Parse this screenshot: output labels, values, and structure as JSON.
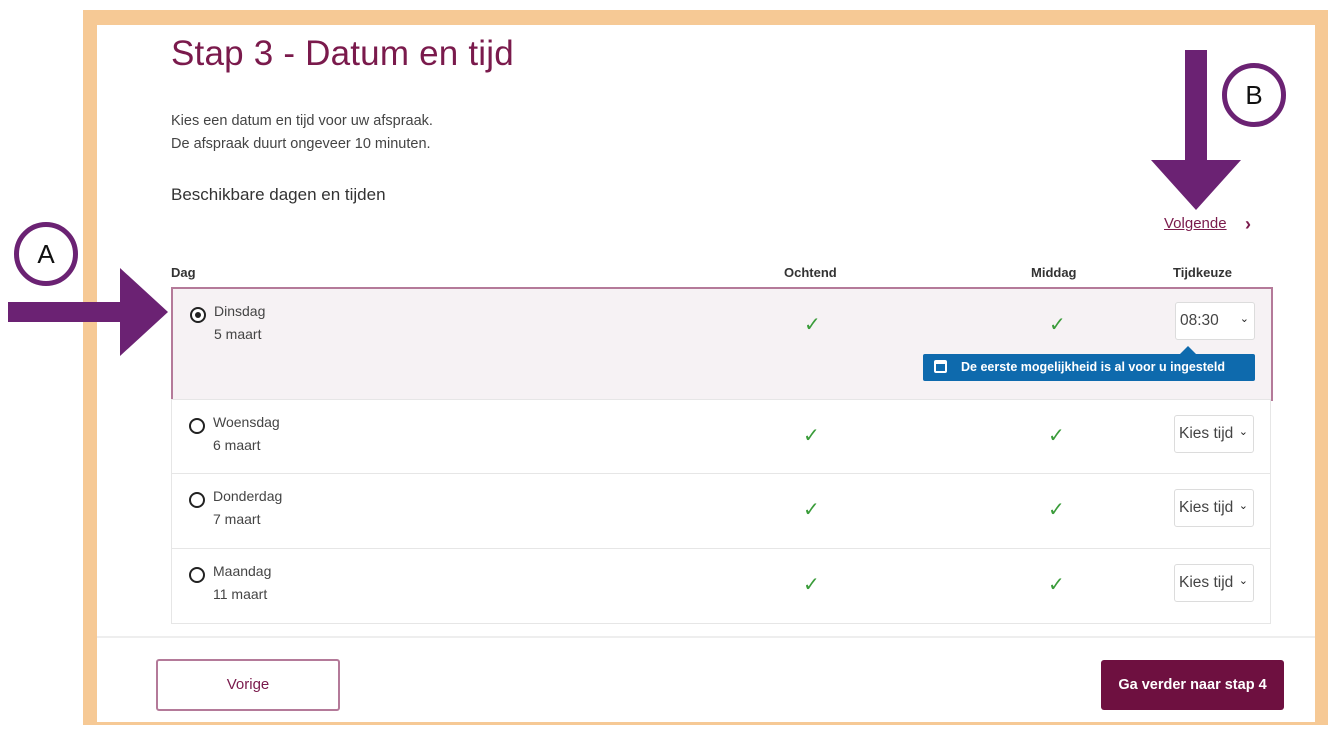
{
  "page": {
    "title": "Stap 3 - Datum en tijd",
    "intro_line1": "Kies een datum en tijd voor uw afspraak.",
    "intro_line2": "De afspraak duurt ongeveer 10 minuten.",
    "subhead": "Beschikbare dagen en tijden",
    "next_link": "Volgende",
    "next_chevron": "›"
  },
  "table": {
    "headers": {
      "day": "Dag",
      "morning": "Ochtend",
      "afternoon": "Middag",
      "time": "Tijdkeuze"
    },
    "check_glyph": "✓",
    "caret_glyph": "⌄",
    "rows": [
      {
        "day": "Dinsdag",
        "date": "5 maart",
        "selected": true,
        "time": "08:30"
      },
      {
        "day": "Woensdag",
        "date": "6 maart",
        "selected": false,
        "time": "Kies tijd"
      },
      {
        "day": "Donderdag",
        "date": "7 maart",
        "selected": false,
        "time": "Kies tijd"
      },
      {
        "day": "Maandag",
        "date": "11 maart",
        "selected": false,
        "time": "Kies tijd"
      }
    ],
    "tooltip": "De eerste mogelijkheid is al voor u ingesteld"
  },
  "footer": {
    "prev_label": "Vorige",
    "next_label": "Ga verder naar stap 4"
  },
  "annotations": {
    "a_label": "A",
    "b_label": "B",
    "color": "#6b2273"
  },
  "colors": {
    "brand": "#7a1a4c",
    "primary_button": "#6e1040",
    "tooltip": "#0e6aad",
    "check": "#3a9c3a",
    "frame": "#f6c995"
  }
}
